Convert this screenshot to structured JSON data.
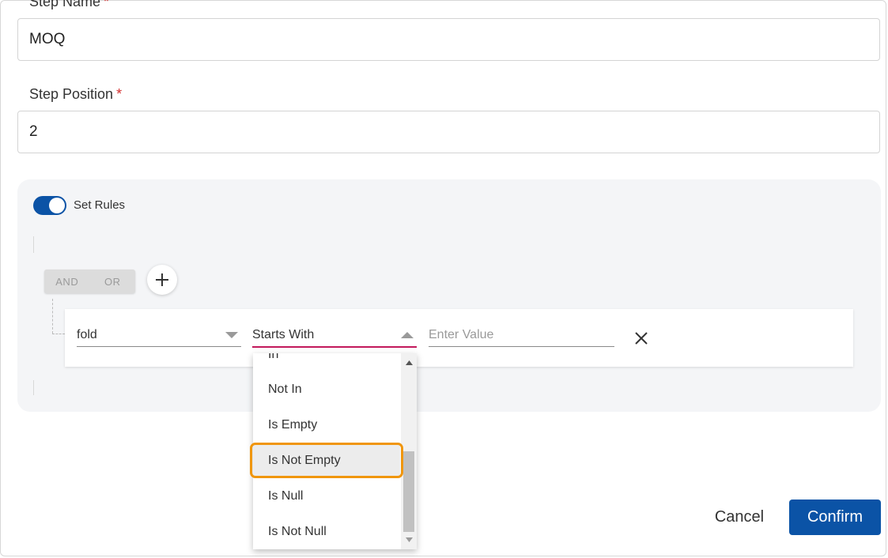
{
  "step_name": {
    "label": "Step Name",
    "required_mark": "*",
    "value": "MOQ"
  },
  "step_position": {
    "label": "Step Position",
    "required_mark": "*",
    "value": "2"
  },
  "rules": {
    "toggle_label": "Set Rules",
    "toggle_on": true,
    "and_label": "AND",
    "or_label": "OR",
    "rule": {
      "field_value": "fold",
      "operator_value": "Starts With",
      "value_placeholder": "Enter Value"
    },
    "operator_options": [
      "In",
      "Not In",
      "Is Empty",
      "Is Not Empty",
      "Is Null",
      "Is Not Null"
    ],
    "highlighted_option": "Is Not Empty"
  },
  "footer": {
    "cancel_label": "Cancel",
    "confirm_label": "Confirm"
  },
  "colors": {
    "primary": "#0b53a6",
    "required": "#d32f2f",
    "highlight": "#f0960e",
    "active_underline": "#c2185b"
  }
}
